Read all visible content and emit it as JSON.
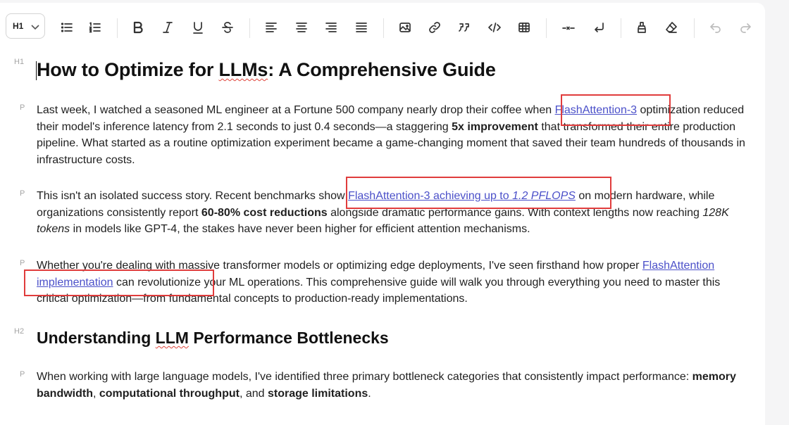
{
  "toolbar": {
    "heading_value": "H1",
    "icons": [
      "bullet-list-icon",
      "ordered-list-icon",
      "bold-icon",
      "italic-icon",
      "underline-icon",
      "strikethrough-icon",
      "align-left-icon",
      "align-center-icon",
      "align-right-icon",
      "align-justify-icon",
      "image-icon",
      "link-icon",
      "quote-icon",
      "code-icon",
      "table-icon",
      "horizontal-rule-icon",
      "hard-break-icon",
      "highlight-icon",
      "clear-format-icon",
      "undo-icon",
      "redo-icon"
    ]
  },
  "doc": {
    "h1_tag": "H1",
    "h1_before": "How to Optimize for ",
    "h1_spell": "LLMs",
    "h1_after": ": A Comprehensive Guide",
    "p_tag": "P",
    "p1": {
      "t1": "Last week, I watched a seasoned ML engineer at a Fortune 500 company nearly drop their coffee when ",
      "link": "FlashAttention-3",
      "t2": " optimization reduced their model's inference latency from 2.1 seconds to just 0.4 seconds—a staggering ",
      "bold": "5x improvement",
      "t3": " that transformed their entire production pipeline. What started as a routine optimization experiment became a game-changing moment that saved their team hundreds of thousands in infrastructure costs."
    },
    "p2": {
      "t1": "This isn't an isolated success story. Recent benchmarks show ",
      "link": "FlashAttention-3 achieving up to ",
      "link_em": "1.2 PFLOPS",
      "t2": " on modern hardware, while organizations consistently report ",
      "bold": "60-80% cost reductions",
      "t3": " alongside dramatic performance gains. With context lengths now reaching ",
      "em": "128K tokens",
      "t4": " in models like GPT-4, the stakes have never been higher for efficient attention mechanisms."
    },
    "p3": {
      "t1": "Whether you're dealing with massive transformer models or optimizing edge deployments, I've seen firsthand how proper ",
      "link": "FlashAttention implementation",
      "t2": " can revolutionize your ML operations. This comprehensive guide will walk you through everything you need to master this critical optimization—from fundamental concepts to production-ready implementations."
    },
    "h2_tag": "H2",
    "h2_before": "Understanding ",
    "h2_spell": "LLM",
    "h2_after": " Performance Bottlenecks",
    "p4": {
      "t1": "When working with large language models, I've identified three primary bottleneck categories that consistently impact performance: ",
      "b1": "memory bandwidth",
      "t2": ", ",
      "b2": "computational throughput",
      "t3": ", and ",
      "b3": "storage limitations",
      "t4": "."
    }
  },
  "colors": {
    "link": "#4b50c9",
    "highlight_box": "#e03c3c",
    "spellcheck": "#e0453c"
  }
}
